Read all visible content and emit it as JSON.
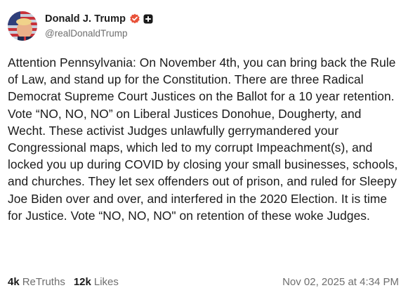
{
  "author": {
    "display_name": "Donald J. Trump",
    "handle": "@realDonaldTrump",
    "verified_color": "#e8523a"
  },
  "post": {
    "text": "Attention Pennsylvania: On November 4th, you can bring back the Rule of Law, and stand up for the Constitution. There are three Radical Democrat Supreme Court Justices on the Ballot for a 10 year retention. Vote “NO, NO, NO” on Liberal Justices Donohue, Dougherty, and Wecht. These activist Judges unlawfully gerrymandered your Congressional maps, which led to my corrupt Impeachment(s), and locked you up during COVID by closing your small businesses, schools, and churches. They let sex offenders out of prison, and ruled for Sleepy Joe Biden over and over, and interfered in the 2020 Election. It is time for Justice. Vote “NO, NO, NO\" on retention of these woke Judges."
  },
  "stats": {
    "retruths_count": "4k",
    "retruths_label": "ReTruths",
    "likes_count": "12k",
    "likes_label": "Likes"
  },
  "timestamp": "Nov 02, 2025 at 4:34 PM",
  "icons": {
    "verified": "verified-check-icon",
    "badge": "plus-badge-icon"
  }
}
